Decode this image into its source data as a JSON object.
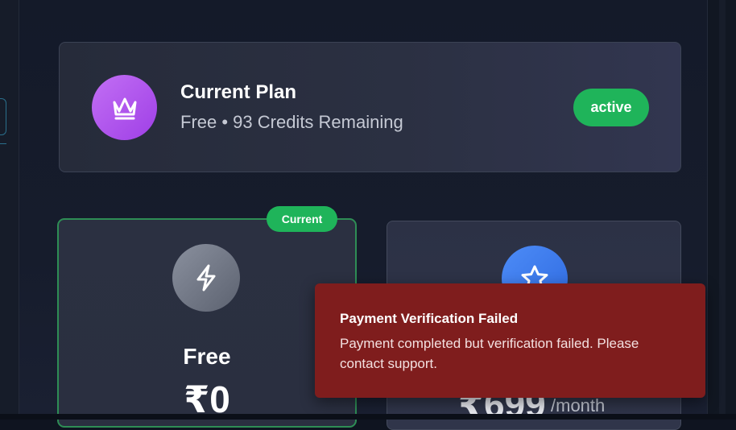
{
  "current_plan": {
    "title": "Current Plan",
    "subtitle": "Free • 93 Credits Remaining",
    "status_badge": "active",
    "icon": "crown-icon"
  },
  "plans": [
    {
      "name": "Free",
      "price": "₹0",
      "tag": "Current",
      "icon": "lightning-icon",
      "is_current": true
    },
    {
      "price": "₹699",
      "period": "/month",
      "icon": "star-icon"
    }
  ],
  "toast": {
    "title": "Payment Verification Failed",
    "message": "Payment completed but verification failed. Please contact support."
  },
  "colors": {
    "success": "#1fb45a",
    "error": "#7f1d1d",
    "crown_gradient": "#b45cf0",
    "star_gradient": "#3f7cf0"
  }
}
